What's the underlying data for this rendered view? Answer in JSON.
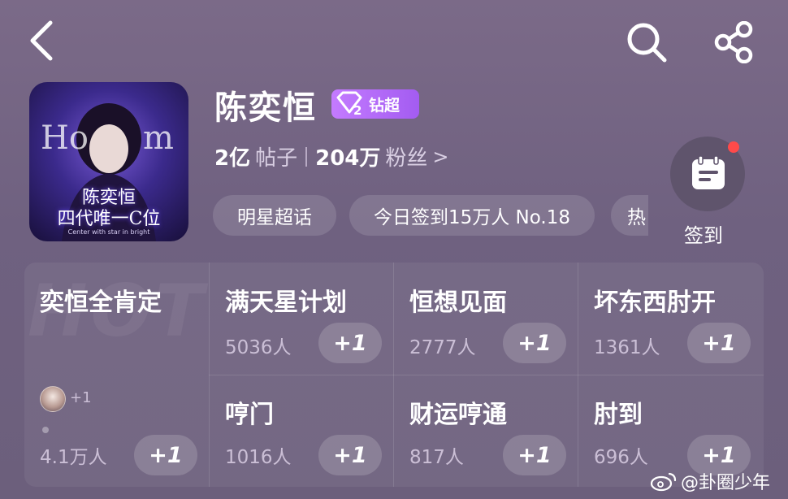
{
  "header": {
    "back_icon": "chevron-left-icon",
    "search_icon": "search-icon",
    "share_icon": "share-icon"
  },
  "supertopic": {
    "cover_title_line1": "陈奕恒",
    "cover_title_line2": "四代唯一C位",
    "cover_caption": "Center with star in bright",
    "name": "陈奕恒",
    "badge_level": "2",
    "badge_label": "钻超",
    "posts_num": "2亿",
    "posts_unit": "帖子",
    "fans_num": "204万",
    "fans_unit": "粉丝",
    "fans_chevron": ">"
  },
  "chips": [
    "明星超话",
    "今日签到15万人 No.18",
    "热"
  ],
  "checkin": {
    "label": "签到",
    "has_notification": true
  },
  "grid": {
    "hot_watermark": "HOT",
    "featured": {
      "title": "奕恒全肯定",
      "avatar_plus": "+1",
      "count": "4.1万人",
      "button": "+1"
    },
    "items": [
      {
        "title": "满天星计划",
        "count": "5036人",
        "button": "+1"
      },
      {
        "title": "恒想见面",
        "count": "2777人",
        "button": "+1"
      },
      {
        "title": "坏东西肘开",
        "count": "1361人",
        "button": "+1"
      },
      {
        "title": "哼门",
        "count": "1016人",
        "button": "+1"
      },
      {
        "title": "财运哼通",
        "count": "817人",
        "button": "+1"
      },
      {
        "title": "肘到",
        "count": "696人",
        "button": "+1"
      }
    ]
  },
  "watermark": "@卦圈少年",
  "colors": {
    "badge": "#b36af8",
    "notification_dot": "#ff4a4a",
    "background": "#74668a"
  }
}
